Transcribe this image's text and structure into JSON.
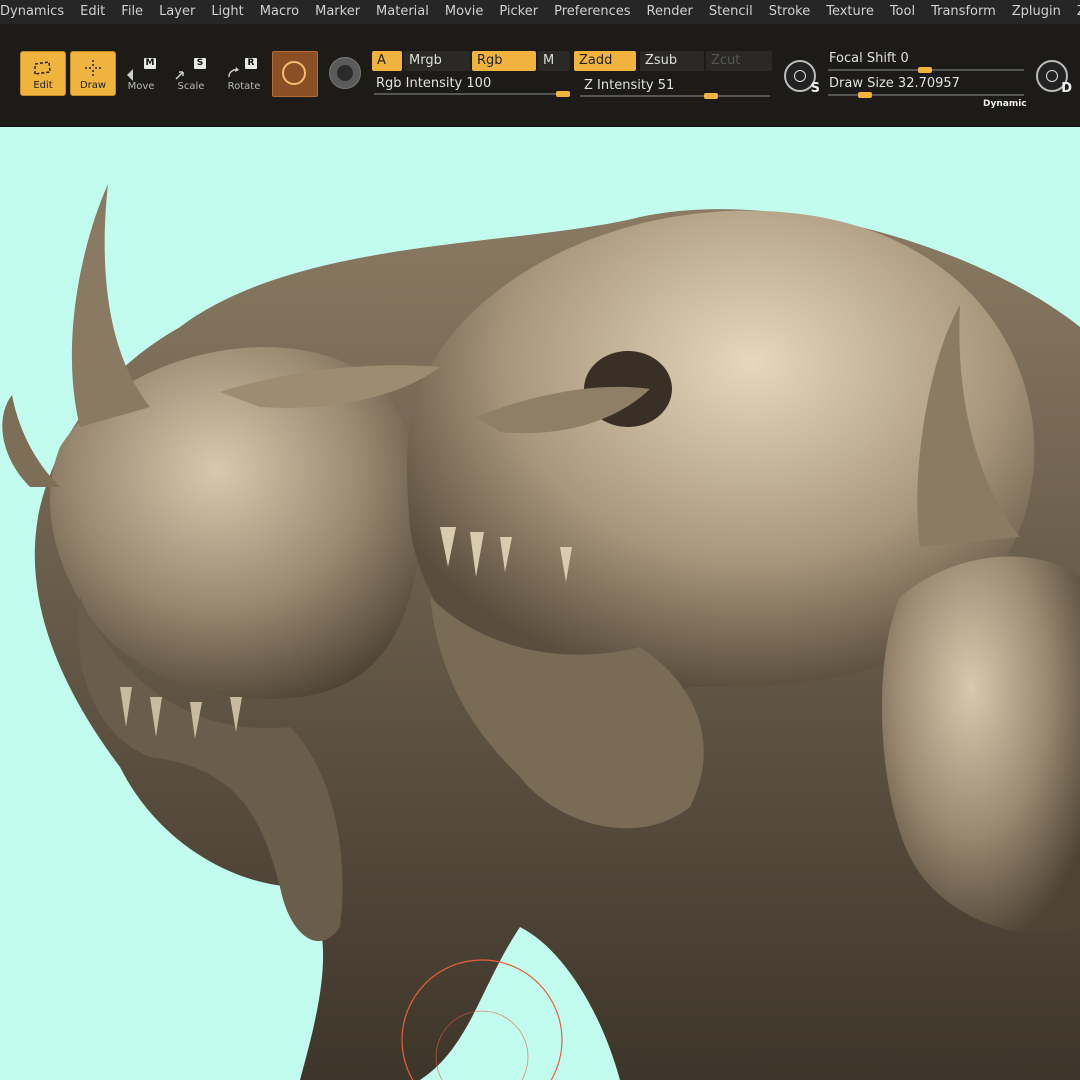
{
  "menu": [
    "Dynamics",
    "Edit",
    "File",
    "Layer",
    "Light",
    "Macro",
    "Marker",
    "Material",
    "Movie",
    "Picker",
    "Preferences",
    "Render",
    "Stencil",
    "Stroke",
    "Texture",
    "Tool",
    "Transform",
    "Zplugin",
    "Zscript"
  ],
  "toolbar": {
    "edit": "Edit",
    "draw": "Draw",
    "move": "Move",
    "scale": "Scale",
    "rotate": "Rotate",
    "move_key": "M",
    "scale_key": "S",
    "rotate_key": "R",
    "a": "A",
    "mrgb": "Mrgb",
    "rgb": "Rgb",
    "m": "M",
    "rgb_intensity_label": "Rgb Intensity",
    "rgb_intensity_value": "100",
    "zadd": "Zadd",
    "zsub": "Zsub",
    "zcut": "Zcut",
    "z_intensity_label": "Z Intensity",
    "z_intensity_value": "51",
    "focal_shift_label": "Focal Shift",
    "focal_shift_value": "0",
    "draw_size_label": "Draw Size",
    "draw_size_value": "32.70957",
    "dynamic": "Dynamic",
    "s_letter": "S",
    "d_letter": "D"
  },
  "colors": {
    "accent": "#f0b33e",
    "canvas_bg": "#c2fcee",
    "sculpt": "#9b8a72",
    "toolbar_bg": "#1c1b18"
  },
  "icons": {
    "edit": "edit-icon",
    "draw": "draw-crosshair-icon",
    "move": "move-icon",
    "scale": "scale-icon",
    "rotate": "rotate-icon",
    "material": "material-sphere-icon",
    "texture": "texture-icon"
  }
}
